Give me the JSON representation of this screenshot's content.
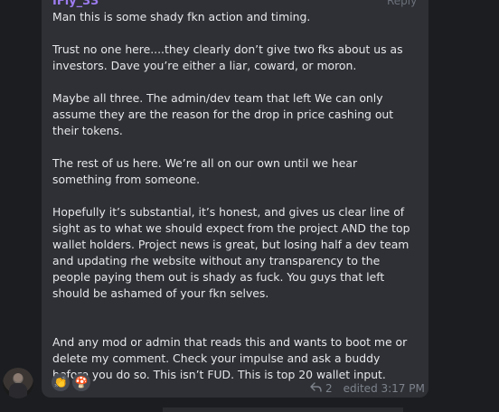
{
  "message": {
    "sender": "IFly_33",
    "reply_label": "Reply",
    "paragraphs": [
      "Man this is some shady fkn action and timing.",
      "Trust no one here....they clearly don’t give two fks about us as investors. Dave you’re either a liar, coward, or moron.",
      "Maybe all three. The admin/dev team that left We can only assume they are the reason for the drop in price cashing out their tokens.",
      "The rest of us here. We’re all on our own until we hear something from someone.",
      "Hopefully it’s substantial, it’s honest, and gives us clear line of sight as to what we should expect from the project AND  the top wallet holders. Project news is great, but losing half a dev team and updating rhe website without any transparency to the people paying them out is shady as fuck. You guys that left should be ashamed of your fkn selves.",
      "And any mod or admin that reads this and wants to boot me  or delete my comment. Check your impulse and ask a buddy before you do so.  This isn’t FUD. This is top 20 wallet input."
    ],
    "reactions": [
      {
        "icon": "clapping-hands-icon",
        "glyph": "👏"
      },
      {
        "icon": "green-mushroom-icon",
        "glyph": "🍄"
      }
    ],
    "reply_count": "2",
    "edited_label": "edited 3:17 PM"
  }
}
